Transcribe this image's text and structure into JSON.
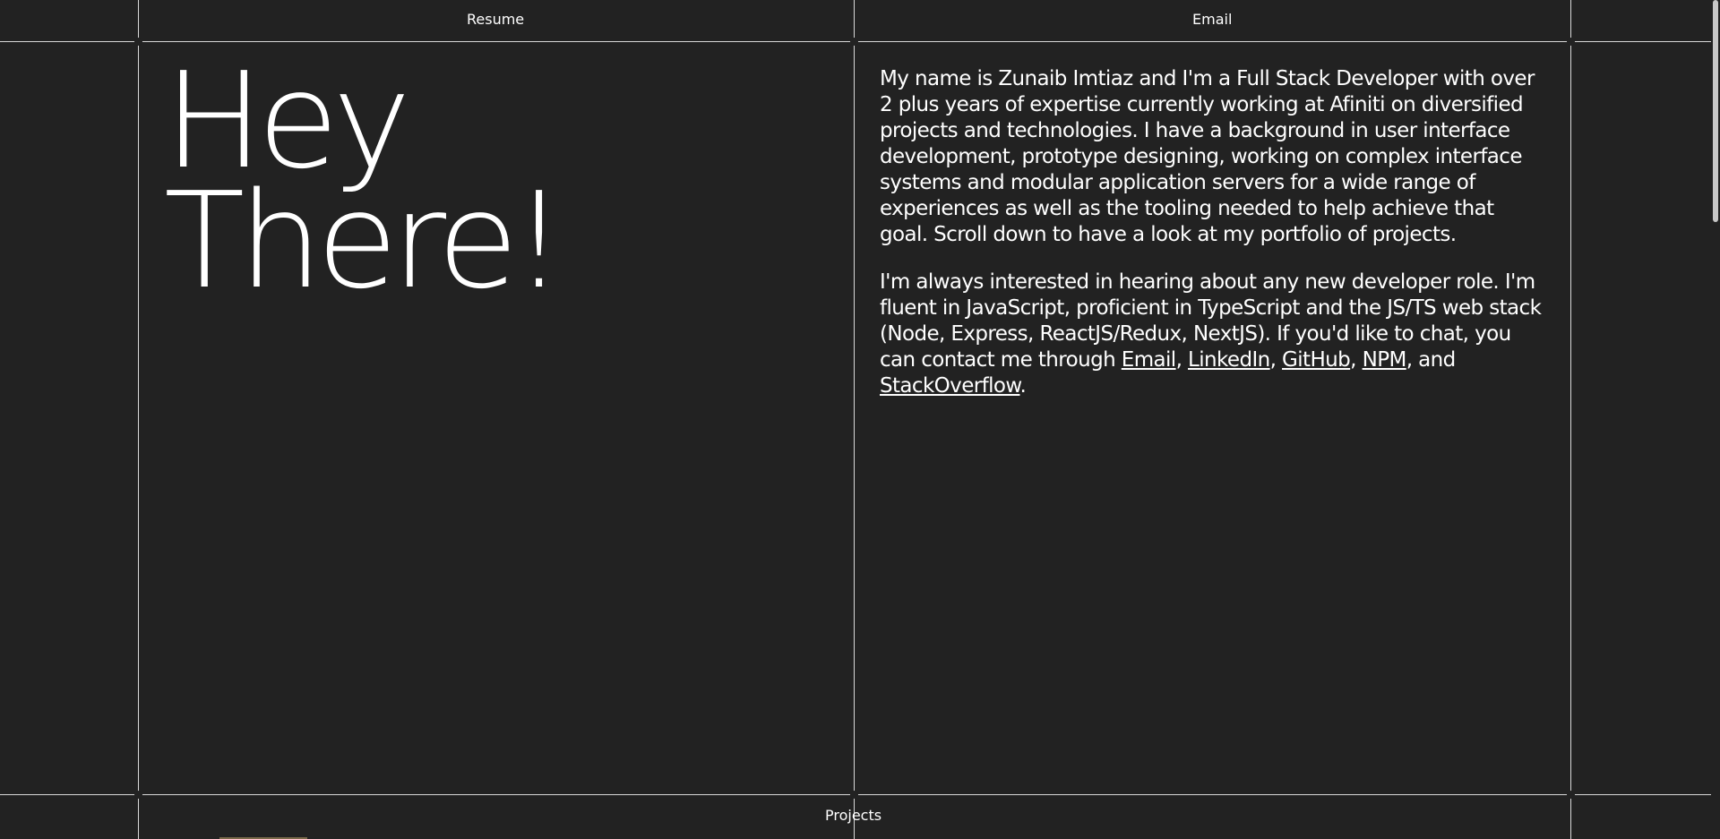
{
  "nav": {
    "resume": "Resume",
    "email": "Email",
    "projects": "Projects"
  },
  "hero": {
    "line1": "Hey",
    "line2": "There!"
  },
  "bio": {
    "paragraph1": "My name is Zunaib Imtiaz and I'm a Full Stack Developer with over 2 plus years of expertise currently working at Afiniti on diversified projects and technologies. I have a background in user interface development, prototype designing, working on complex interface systems and modular application servers for a wide range of experiences as well as the tooling needed to help achieve that goal. Scroll down to have a look at my portfolio of projects.",
    "paragraph2_text": "I'm always interested in hearing about any new developer role. I'm fluent in JavaScript, proficient in TypeScript and the JS/TS web stack (Node, Express, ReactJS/Redux, NextJS). If you'd like to chat, you can contact me through ",
    "links": {
      "email": "Email",
      "linkedin": "LinkedIn",
      "github": "GitHub",
      "npm": "NPM",
      "stackoverflow": "StackOverflow"
    },
    "sep1": ", ",
    "sep2": ", ",
    "sep3": ", ",
    "sep4": ", and ",
    "end": "."
  },
  "colors": {
    "background": "#222222",
    "text": "#ffffff",
    "grid": "#d9d9d9"
  }
}
